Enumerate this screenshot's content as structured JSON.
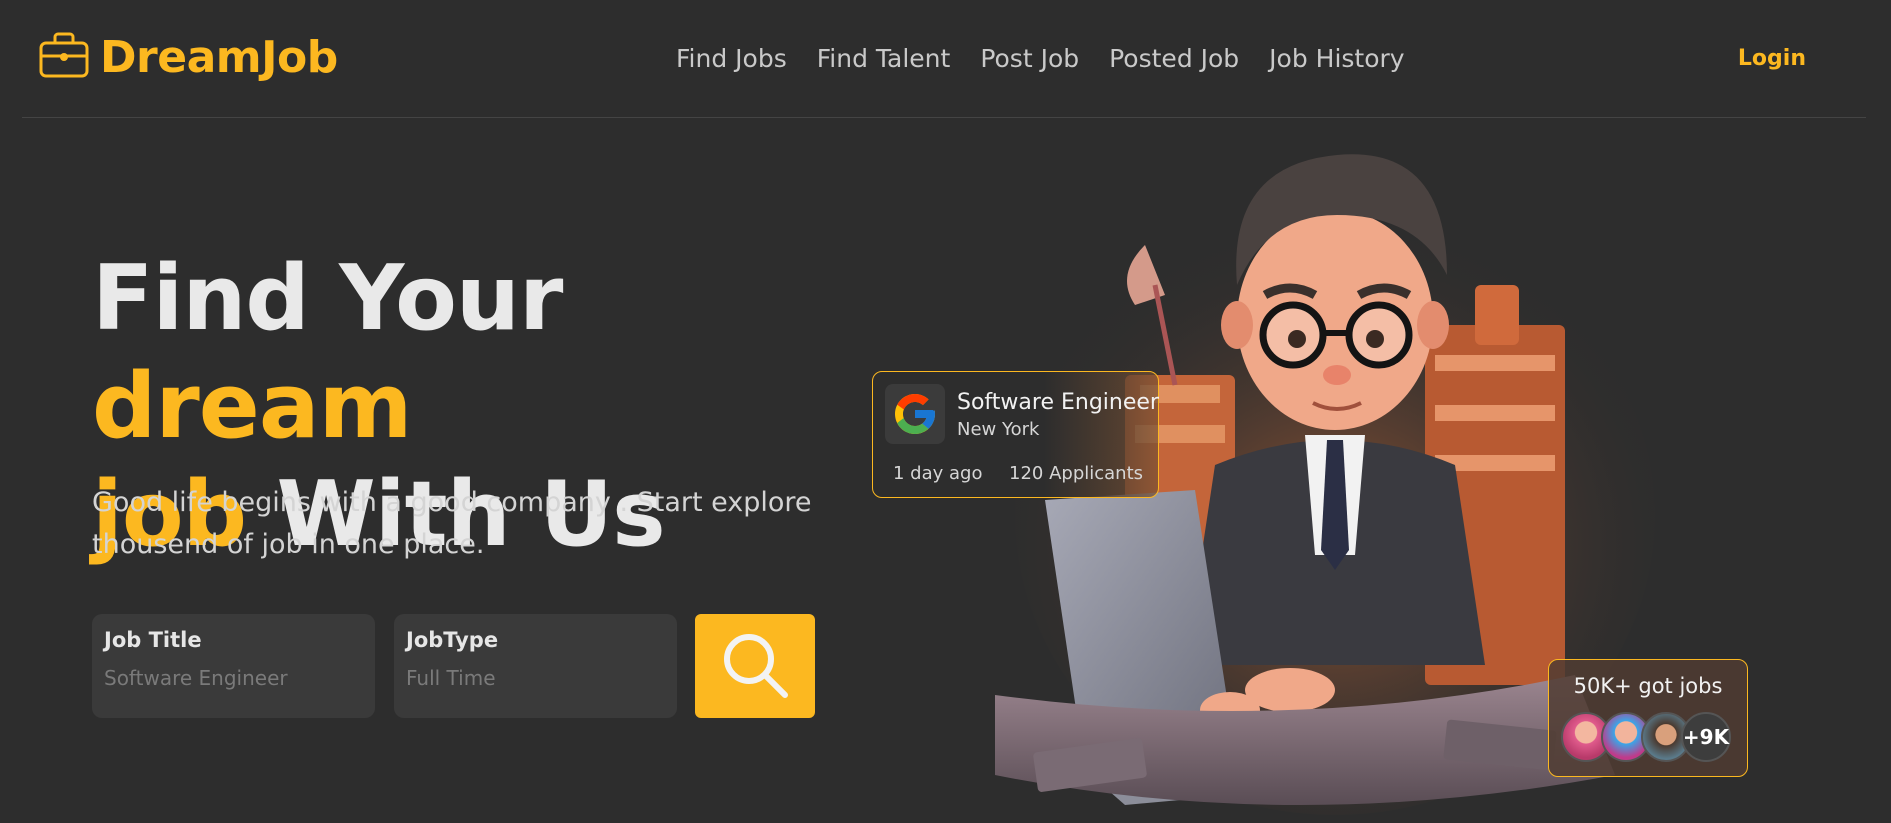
{
  "brand": {
    "name": "DreamJob",
    "icon": "briefcase-icon"
  },
  "nav": {
    "items": [
      "Find Jobs",
      "Find Talent",
      "Post Job",
      "Posted Job",
      "Job History"
    ],
    "login": "Login"
  },
  "hero": {
    "title_part1": "Find Your ",
    "title_highlight1": "dream",
    "title_highlight2": "job",
    "title_part2": " With Us",
    "subtitle": "Good life begins with a good company . Start explore thousend of job in one place."
  },
  "search": {
    "job_title_label": "Job Title",
    "job_title_placeholder": "Software Engineer",
    "job_type_label": "JobType",
    "job_type_placeholder": "Full Time",
    "button_icon": "search-icon"
  },
  "job_card": {
    "company_logo": "google-logo",
    "title": "Software Engineer",
    "location": "New York",
    "posted": "1 day ago",
    "applicants": "120 Applicants"
  },
  "stats_card": {
    "text": "50K+ got jobs",
    "more_count": "+9K"
  },
  "colors": {
    "accent": "#fcb820",
    "background": "#2d2d2d",
    "input_bg": "#3a3a3a"
  }
}
